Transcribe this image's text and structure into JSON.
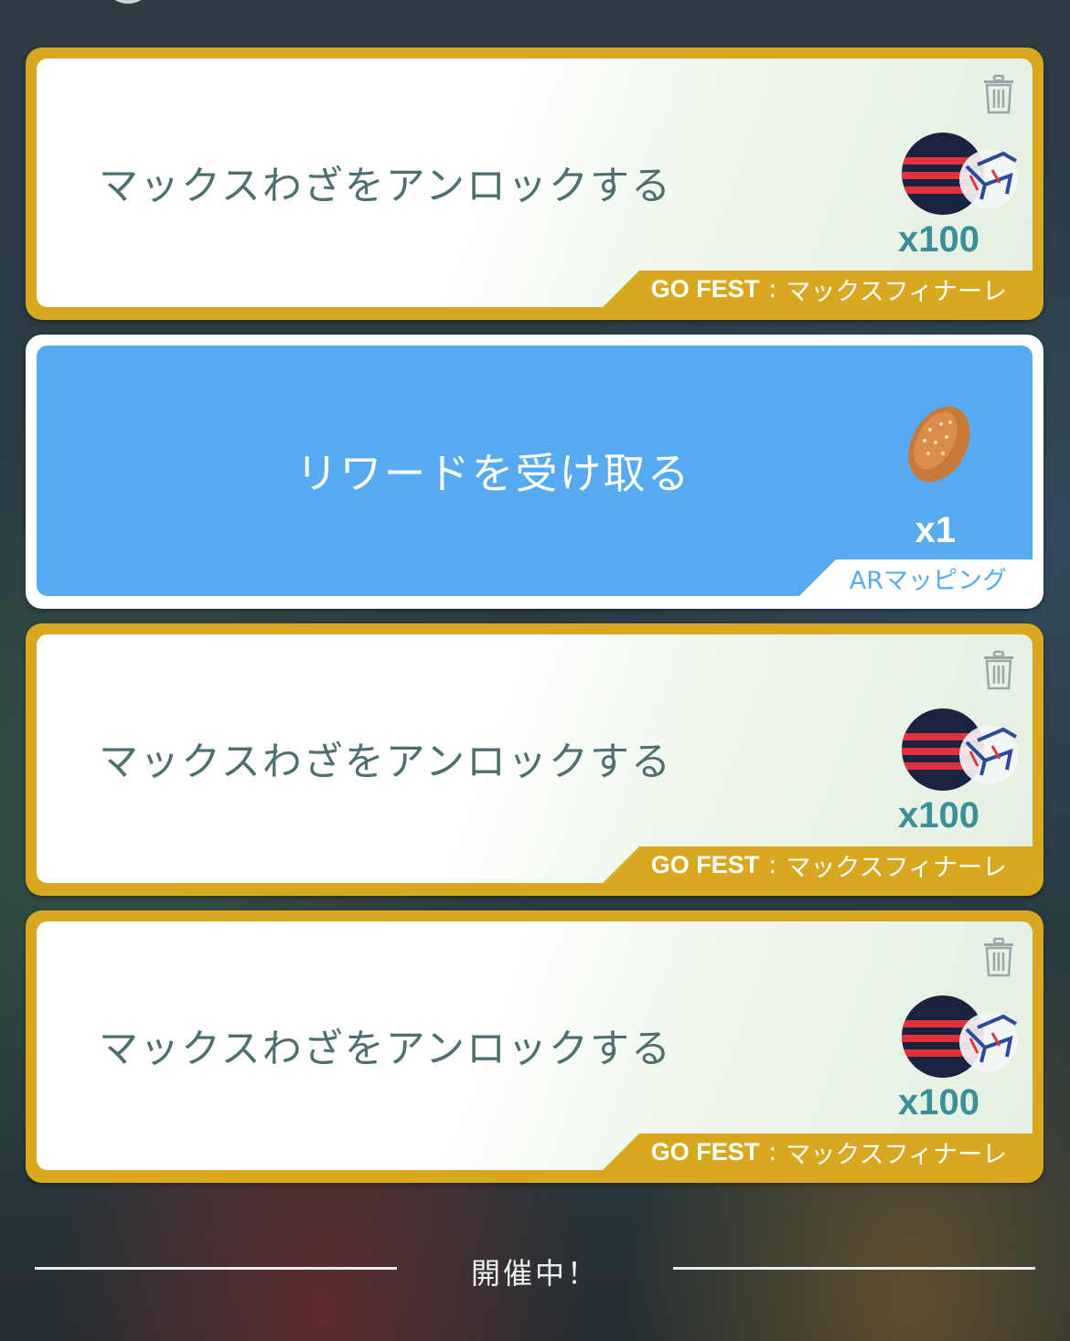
{
  "tasks": [
    {
      "title": "マックスわざをアンロックする",
      "reward_count": "x100",
      "reward_icon": "max-particle-icon",
      "tag_bold": "GO FEST",
      "tag_sep": ":",
      "tag_rest": "マックスフィナーレ"
    },
    {
      "title": "リワードを受け取る",
      "reward_count": "x1",
      "reward_icon": "bread-icon",
      "tag_rest": "ARマッピング"
    },
    {
      "title": "マックスわざをアンロックする",
      "reward_count": "x100",
      "reward_icon": "max-particle-icon",
      "tag_bold": "GO FEST",
      "tag_sep": ":",
      "tag_rest": "マックスフィナーレ"
    },
    {
      "title": "マックスわざをアンロックする",
      "reward_count": "x100",
      "reward_icon": "max-particle-icon",
      "tag_bold": "GO FEST",
      "tag_sep": ":",
      "tag_rest": "マックスフィナーレ"
    }
  ],
  "status": "開催中！",
  "colors": {
    "gold_frame": "#d8a821",
    "claim_blue": "#55aaf0",
    "task_text": "#4d6f70",
    "count_teal": "#3b8f9a"
  }
}
